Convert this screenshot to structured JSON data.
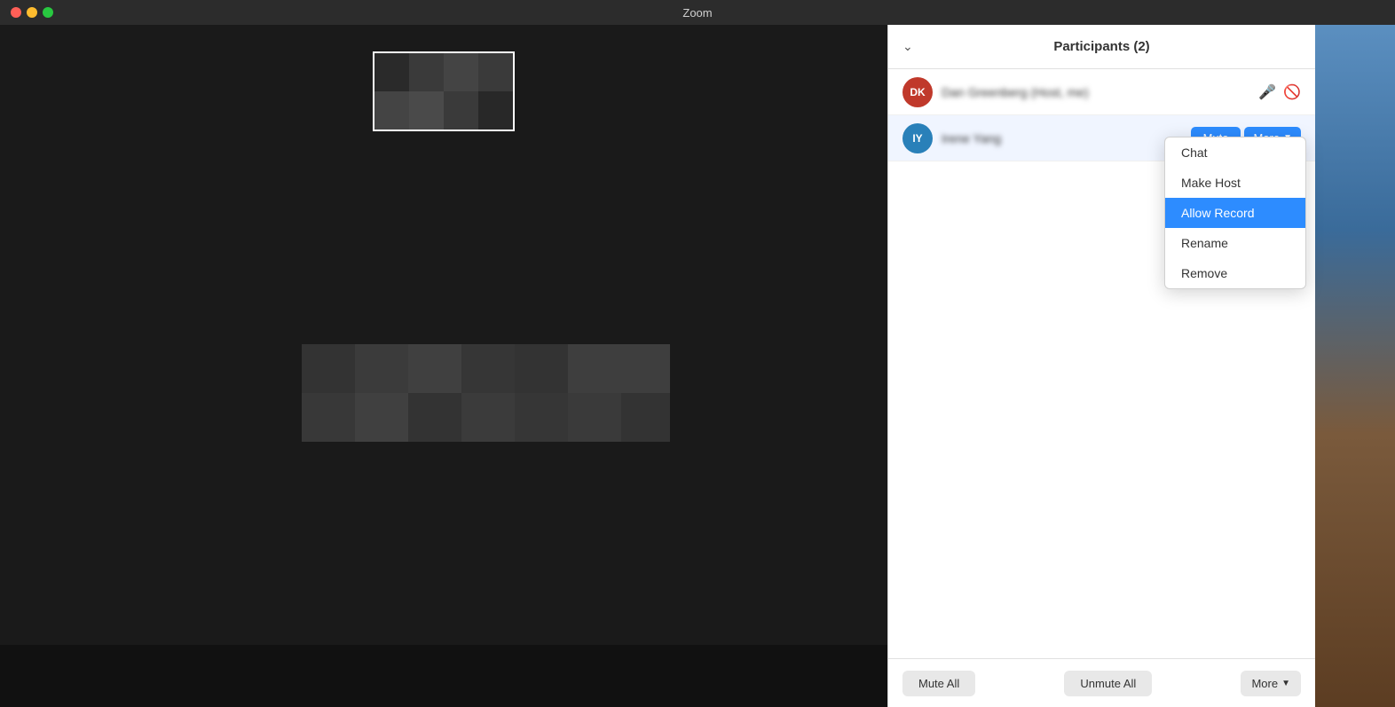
{
  "titleBar": {
    "title": "Zoom"
  },
  "participants": {
    "panelTitle": "Participants (2)",
    "items": [
      {
        "initials": "DK",
        "name": "Dan Greenberg",
        "suffix": " (Host, me)",
        "avatarClass": "avatar-dk",
        "hasAudio": true,
        "hasVideo": false
      },
      {
        "initials": "IY",
        "name": "Irene Yang",
        "suffix": "",
        "avatarClass": "avatar-iy",
        "muteLabel": "Mute",
        "moreLabel": "More"
      }
    ]
  },
  "dropdown": {
    "items": [
      {
        "label": "Chat",
        "active": false
      },
      {
        "label": "Make Host",
        "active": false
      },
      {
        "label": "Allow Record",
        "active": true
      },
      {
        "label": "Rename",
        "active": false
      },
      {
        "label": "Remove",
        "active": false
      }
    ]
  },
  "footer": {
    "muteAllLabel": "Mute All",
    "unmuteAllLabel": "Unmute All",
    "moreLabel": "More"
  }
}
